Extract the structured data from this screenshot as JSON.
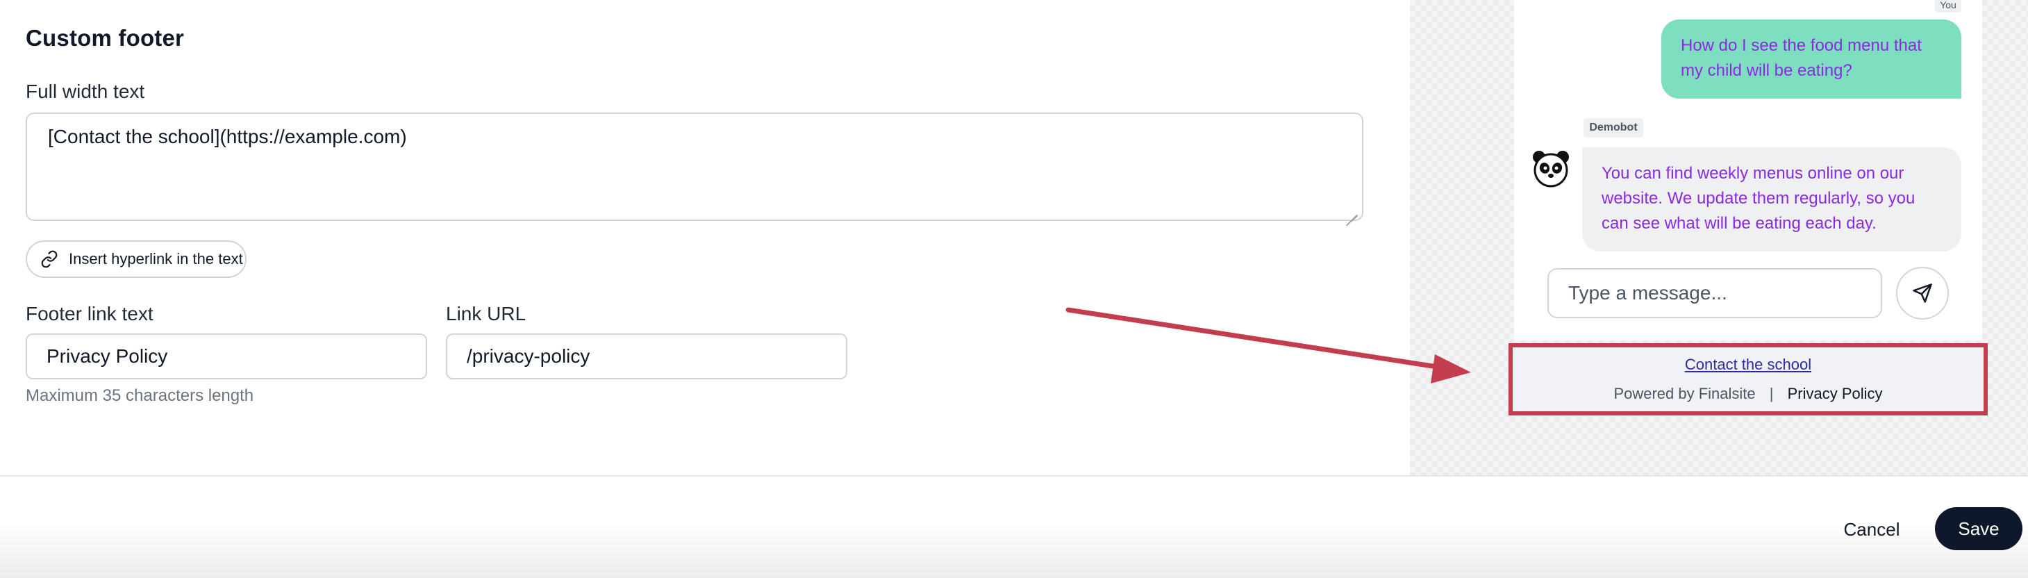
{
  "form": {
    "section_title": "Custom footer",
    "full_width_label": "Full width text",
    "full_width_value": "[Contact the school](https://example.com)",
    "insert_link_button": "Insert hyperlink in the text",
    "footer_link_text_label": "Footer link text",
    "footer_link_text_value": "Privacy Policy",
    "link_url_label": "Link URL",
    "link_url_value": "/privacy-policy",
    "helper_text": "Maximum 35 characters length"
  },
  "preview": {
    "you_tag": "You",
    "user_message": "How do I see the food menu that my child will be eating?",
    "bot_name": "Demobot",
    "bot_message": "You can find weekly menus online on our website. We update them regularly, so you can see what will be eating each day.",
    "message_placeholder": "Type a message...",
    "footer_link": "Contact the school",
    "powered_by": "Powered by Finalsite",
    "separator": "|",
    "privacy_policy": "Privacy Policy",
    "colors": {
      "user_bubble": "#7ddfbf",
      "bot_bubble": "#eef0f2",
      "message_text": "#8a2be2",
      "highlight_box": "#c43d4f",
      "arrow": "#c43d4f"
    },
    "icons": [
      "link-icon",
      "panda-avatar-icon",
      "send-icon",
      "annotation-arrow"
    ]
  },
  "actions": {
    "cancel_label": "Cancel",
    "save_label": "Save",
    "save_color": "#0f172a"
  }
}
